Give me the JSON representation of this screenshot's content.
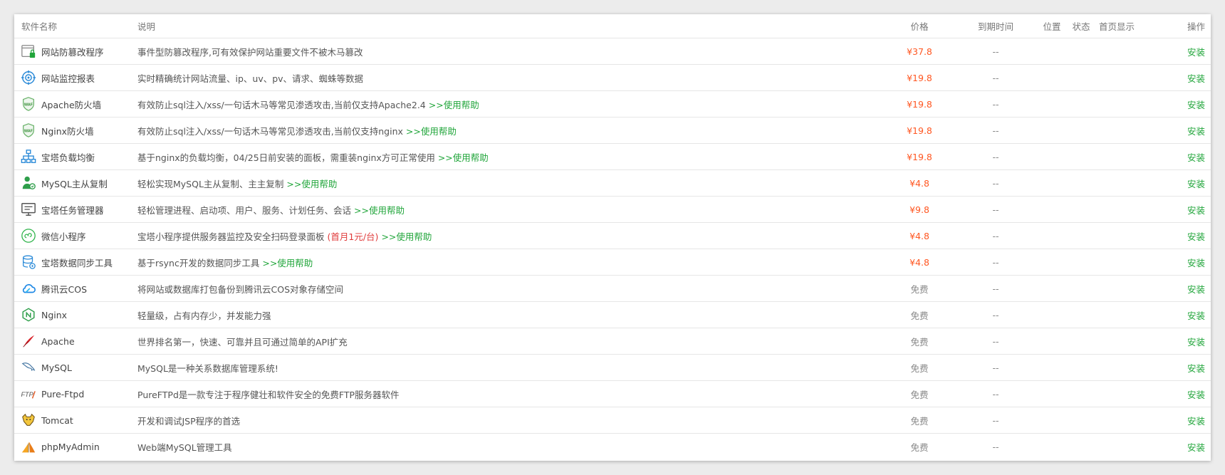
{
  "headers": {
    "name": "软件名称",
    "desc": "说明",
    "price": "价格",
    "expire": "到期时间",
    "location": "位置",
    "status": "状态",
    "home": "首页显示",
    "op": "操作"
  },
  "colors": {
    "accent": "#20a53a",
    "price": "#ff5722",
    "promo": "#e03b3b"
  },
  "rows": [
    {
      "icon": "tamper-proof-icon",
      "name": "网站防篡改程序",
      "desc": "事件型防篡改程序,可有效保护网站重要文件不被木马篡改",
      "help": "",
      "promo": "",
      "price": "¥37.8",
      "paid": true,
      "expire": "--",
      "op": "安装"
    },
    {
      "icon": "site-monitor-icon",
      "name": "网站监控报表",
      "desc": "实时精确统计网站流量、ip、uv、pv、请求、蜘蛛等数据",
      "help": "",
      "promo": "",
      "price": "¥19.8",
      "paid": true,
      "expire": "--",
      "op": "安装"
    },
    {
      "icon": "waf-shield-icon",
      "name": "Apache防火墙",
      "desc": "有效防止sql注入/xss/一句话木马等常见渗透攻击,当前仅支持Apache2.4",
      "help": ">>使用帮助",
      "promo": "",
      "price": "¥19.8",
      "paid": true,
      "expire": "--",
      "op": "安装"
    },
    {
      "icon": "waf-shield-icon",
      "name": "Nginx防火墙",
      "desc": "有效防止sql注入/xss/一句话木马等常见渗透攻击,当前仅支持nginx",
      "help": ">>使用帮助",
      "promo": "",
      "price": "¥19.8",
      "paid": true,
      "expire": "--",
      "op": "安装"
    },
    {
      "icon": "load-balance-icon",
      "name": "宝塔负载均衡",
      "desc": "基于nginx的负载均衡，04/25日前安装的面板，需重装nginx方可正常使用",
      "help": ">>使用帮助",
      "promo": "",
      "price": "¥19.8",
      "paid": true,
      "expire": "--",
      "op": "安装"
    },
    {
      "icon": "mysql-replication-icon",
      "name": "MySQL主从复制",
      "desc": "轻松实现MySQL主从复制、主主复制",
      "help": ">>使用帮助",
      "promo": "",
      "price": "¥4.8",
      "paid": true,
      "expire": "--",
      "op": "安装"
    },
    {
      "icon": "task-manager-icon",
      "name": "宝塔任务管理器",
      "desc": "轻松管理进程、启动项、用户、服务、计划任务、会话",
      "help": ">>使用帮助",
      "promo": "",
      "price": "¥9.8",
      "paid": true,
      "expire": "--",
      "op": "安装"
    },
    {
      "icon": "mini-program-icon",
      "name": "微信小程序",
      "desc": "宝塔小程序提供服务器监控及安全扫码登录面板",
      "help": ">>使用帮助",
      "promo": "(首月1元/台)",
      "price": "¥4.8",
      "paid": true,
      "expire": "--",
      "op": "安装"
    },
    {
      "icon": "data-sync-icon",
      "name": "宝塔数据同步工具",
      "desc": "基于rsync开发的数据同步工具",
      "help": ">>使用帮助",
      "promo": "",
      "price": "¥4.8",
      "paid": true,
      "expire": "--",
      "op": "安装"
    },
    {
      "icon": "tencent-cloud-icon",
      "name": "腾讯云COS",
      "desc": "将网站或数据库打包备份到腾讯云COS对象存储空间",
      "help": "",
      "promo": "",
      "price": "免费",
      "paid": false,
      "expire": "--",
      "op": "安装"
    },
    {
      "icon": "nginx-icon",
      "name": "Nginx",
      "desc": "轻量级，占有内存少，并发能力强",
      "help": "",
      "promo": "",
      "price": "免费",
      "paid": false,
      "expire": "--",
      "op": "安装"
    },
    {
      "icon": "apache-feather-icon",
      "name": "Apache",
      "desc": "世界排名第一，快速、可靠并且可通过简单的API扩充",
      "help": "",
      "promo": "",
      "price": "免费",
      "paid": false,
      "expire": "--",
      "op": "安装"
    },
    {
      "icon": "mysql-dolphin-icon",
      "name": "MySQL",
      "desc": "MySQL是一种关系数据库管理系统!",
      "help": "",
      "promo": "",
      "price": "免费",
      "paid": false,
      "expire": "--",
      "op": "安装"
    },
    {
      "icon": "ftp-icon",
      "name": "Pure-Ftpd",
      "desc": "PureFTPd是一款专注于程序健壮和软件安全的免费FTP服务器软件",
      "help": "",
      "promo": "",
      "price": "免费",
      "paid": false,
      "expire": "--",
      "op": "安装"
    },
    {
      "icon": "tomcat-icon",
      "name": "Tomcat",
      "desc": "开发和调试JSP程序的首选",
      "help": "",
      "promo": "",
      "price": "免费",
      "paid": false,
      "expire": "--",
      "op": "安装"
    },
    {
      "icon": "phpmyadmin-icon",
      "name": "phpMyAdmin",
      "desc": "Web端MySQL管理工具",
      "help": "",
      "promo": "",
      "price": "免费",
      "paid": false,
      "expire": "--",
      "op": "安装"
    }
  ]
}
